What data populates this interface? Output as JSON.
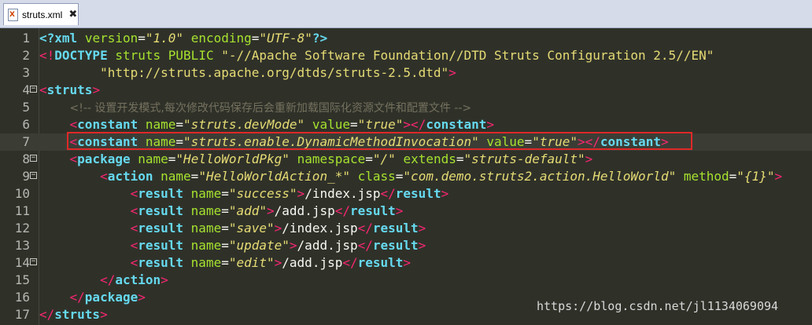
{
  "tab": {
    "icon_glyph": "X",
    "filename": "struts.xml",
    "close_glyph": "✖"
  },
  "lines": [
    {
      "num": "1"
    },
    {
      "num": "2"
    },
    {
      "num": "3"
    },
    {
      "num": "4",
      "fold": "−"
    },
    {
      "num": "5"
    },
    {
      "num": "6"
    },
    {
      "num": "7"
    },
    {
      "num": "8",
      "fold": "−"
    },
    {
      "num": "9",
      "fold": "−"
    },
    {
      "num": "10"
    },
    {
      "num": "11"
    },
    {
      "num": "12"
    },
    {
      "num": "13"
    },
    {
      "num": "14",
      "fold": "−"
    },
    {
      "num": "15"
    },
    {
      "num": "16"
    },
    {
      "num": "17"
    }
  ],
  "code": {
    "l1": {
      "xml": "xml",
      "version_attr": "version",
      "version_val": "\"1.0\"",
      "enc_attr": "encoding",
      "enc_val": "\"UTF-8\""
    },
    "l2": {
      "doctype": "DOCTYPE",
      "root": "struts",
      "public": "PUBLIC",
      "fpi": "\"-//Apache Software Foundation//DTD Struts Configuration 2.5//EN\""
    },
    "l3": {
      "dtd": "\"http://struts.apache.org/dtds/struts-2.5.dtd\""
    },
    "l4": {
      "tag": "struts"
    },
    "l5": {
      "comment": "<!-- 设置开发模式,每次修改代码保存后会重新加载国际化资源文件和配置文件 -->"
    },
    "l6": {
      "tag": "constant",
      "name_attr": "name",
      "name_val": "\"struts.devMode\"",
      "value_attr": "value",
      "value_val": "\"true\"",
      "close": "constant"
    },
    "l7": {
      "tag": "constant",
      "name_attr": "name",
      "name_val": "\"struts.enable.DynamicMethodInvocation\"",
      "value_attr": "value",
      "value_val": "\"true\"",
      "close": "constant"
    },
    "l8": {
      "tag": "package",
      "name_attr": "name",
      "name_val": "\"HelloWorldPkg\"",
      "ns_attr": "namespace",
      "ns_val": "\"/\"",
      "ext_attr": "extends",
      "ext_val": "\"struts-default\""
    },
    "l9": {
      "tag": "action",
      "name_attr": "name",
      "name_val": "\"HelloWorldAction_*\"",
      "class_attr": "class",
      "class_val": "\"com.demo.struts2.action.HelloWorld\"",
      "method_attr": "method",
      "method_val": "\"{1}\""
    },
    "l10": {
      "tag": "result",
      "name_attr": "name",
      "name_val": "\"success\"",
      "text": "/index.jsp",
      "close": "result"
    },
    "l11": {
      "tag": "result",
      "name_attr": "name",
      "name_val": "\"add\"",
      "text": "/add.jsp",
      "close": "result"
    },
    "l12": {
      "tag": "result",
      "name_attr": "name",
      "name_val": "\"save\"",
      "text": "/index.jsp",
      "close": "result"
    },
    "l13": {
      "tag": "result",
      "name_attr": "name",
      "name_val": "\"update\"",
      "text": "/add.jsp",
      "close": "result"
    },
    "l14": {
      "tag": "result",
      "name_attr": "name",
      "name_val": "\"edit\"",
      "text": "/add.jsp",
      "close": "result"
    },
    "l15": {
      "close": "action"
    },
    "l16": {
      "close": "package"
    },
    "l17": {
      "close": "struts"
    }
  },
  "watermark": "https://blog.csdn.net/jl1134069094"
}
